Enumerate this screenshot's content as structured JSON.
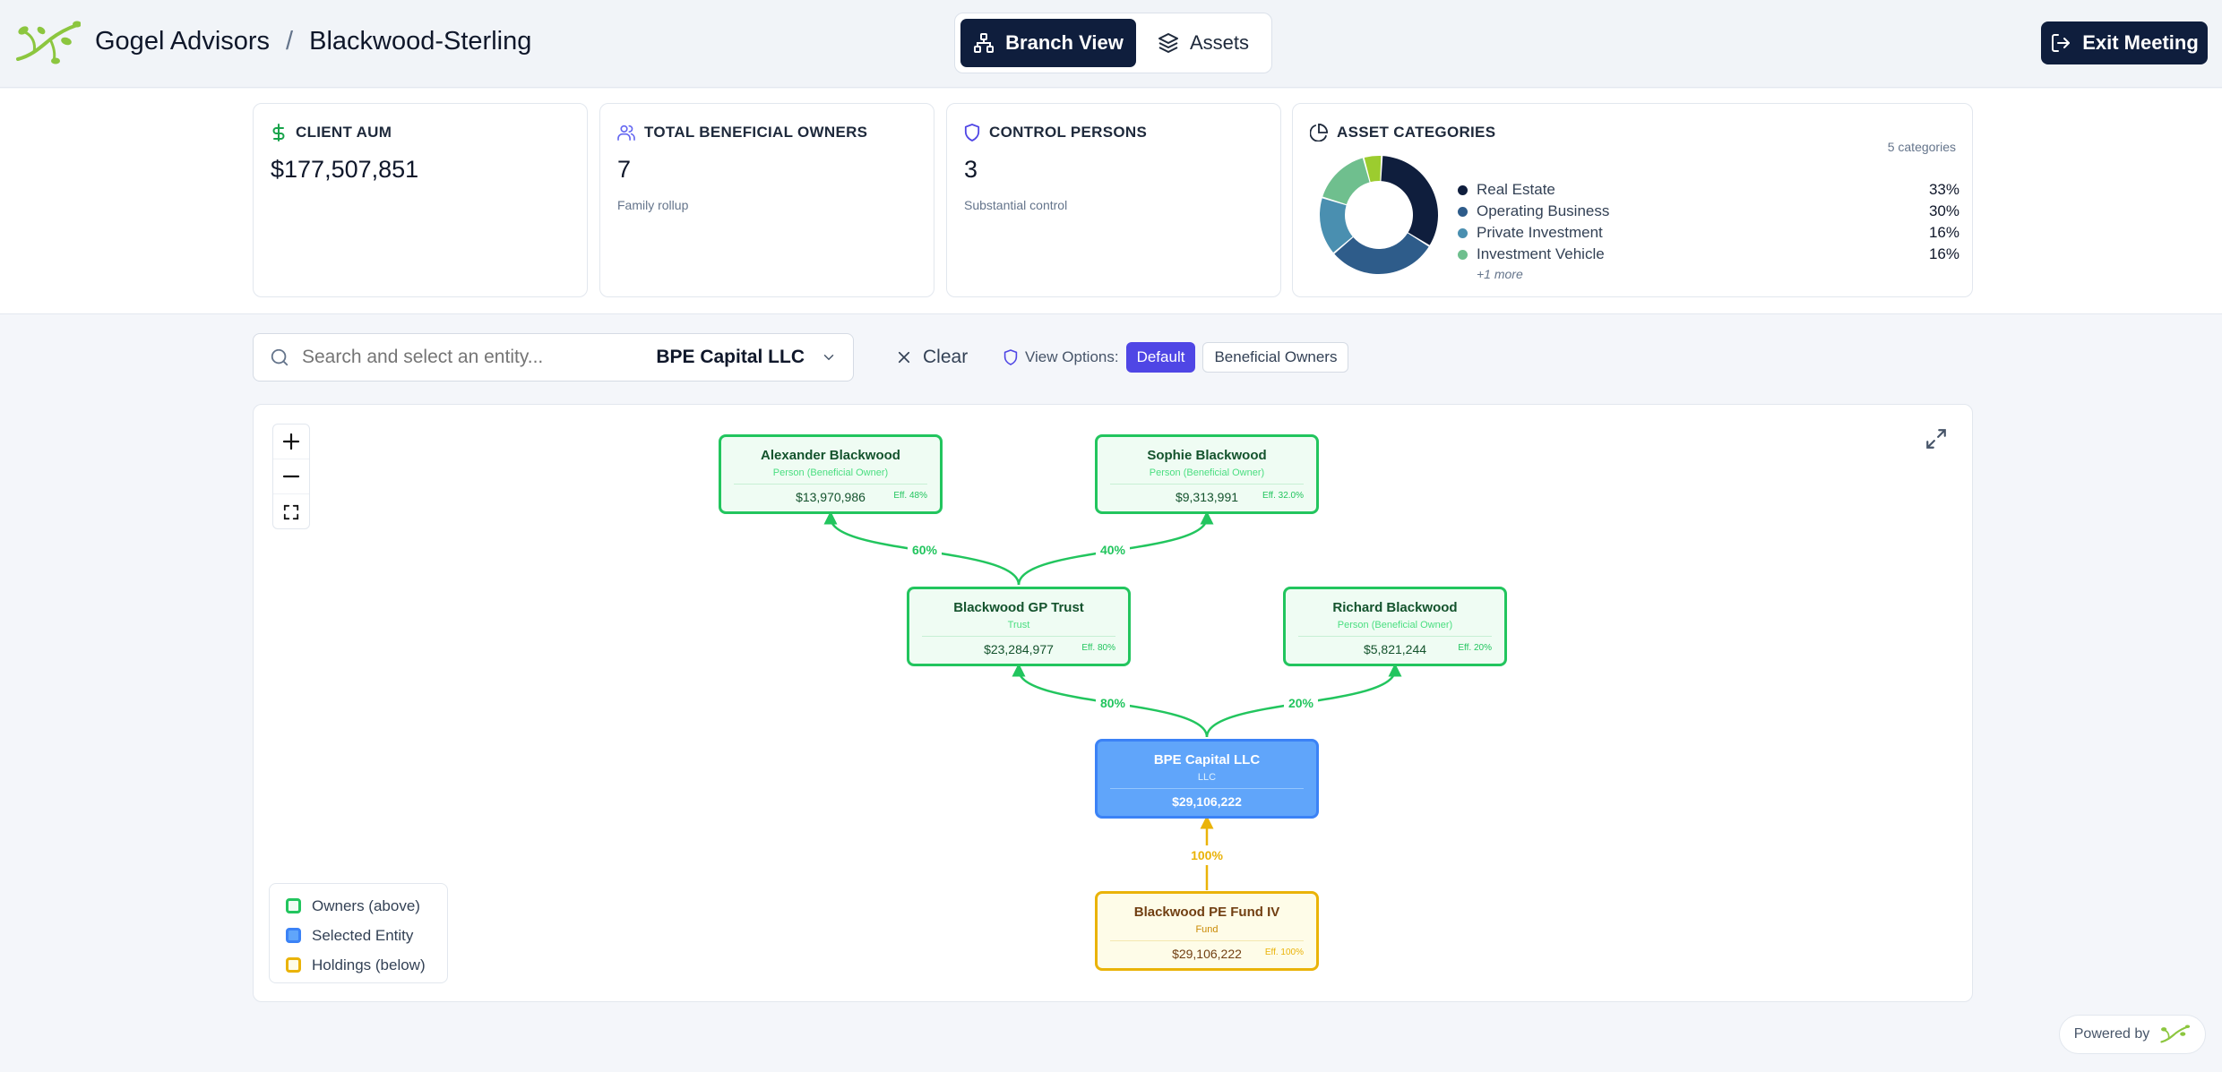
{
  "header": {
    "org": "Gogel Advisors",
    "separator": "/",
    "client": "Blackwood-Sterling",
    "tabs": [
      {
        "label": "Branch View",
        "active": true,
        "icon": "org-chart-icon"
      },
      {
        "label": "Assets",
        "active": false,
        "icon": "layers-icon"
      }
    ],
    "exit_label": "Exit Meeting"
  },
  "stats": {
    "aum": {
      "label": "CLIENT AUM",
      "value": "$177,507,851",
      "icon": "dollar-icon"
    },
    "owners": {
      "label": "TOTAL BENEFICIAL OWNERS",
      "value": "7",
      "sub": "Family rollup",
      "icon": "users-icon"
    },
    "control": {
      "label": "CONTROL PERSONS",
      "value": "3",
      "sub": "Substantial control",
      "icon": "shield-icon"
    },
    "categories": {
      "label": "ASSET CATEGORIES",
      "count": "5 categories",
      "items": [
        {
          "name": "Real Estate",
          "pct": "33%",
          "value": 33,
          "color": "#0f1e3d"
        },
        {
          "name": "Operating Business",
          "pct": "30%",
          "value": 30,
          "color": "#2e5c8a"
        },
        {
          "name": "Private Investment",
          "pct": "16%",
          "value": 16,
          "color": "#4a8fb0"
        },
        {
          "name": "Investment Vehicle",
          "pct": "16%",
          "value": 16,
          "color": "#6fbf8e"
        }
      ],
      "other": {
        "value": 5,
        "color": "#9ccc2f"
      },
      "more": "+1 more"
    }
  },
  "toolbar": {
    "search_placeholder": "Search and select an entity...",
    "selected_entity": "BPE Capital LLC",
    "clear_label": "Clear",
    "view_options_label": "View Options:",
    "options": [
      {
        "label": "Default",
        "active": true
      },
      {
        "label": "Beneficial Owners",
        "active": false
      }
    ]
  },
  "graph": {
    "nodes": {
      "alexander": {
        "name": "Alexander Blackwood",
        "type": "Person (Beneficial Owner)",
        "value": "$13,970,986",
        "eff": "Eff. 48%"
      },
      "sophie": {
        "name": "Sophie Blackwood",
        "type": "Person (Beneficial Owner)",
        "value": "$9,313,991",
        "eff": "Eff. 32.0%"
      },
      "trust": {
        "name": "Blackwood GP Trust",
        "type": "Trust",
        "value": "$23,284,977",
        "eff": "Eff. 80%"
      },
      "richard": {
        "name": "Richard Blackwood",
        "type": "Person (Beneficial Owner)",
        "value": "$5,821,244",
        "eff": "Eff. 20%"
      },
      "bpe": {
        "name": "BPE Capital LLC",
        "type": "LLC",
        "value": "$29,106,222"
      },
      "fund": {
        "name": "Blackwood PE Fund IV",
        "type": "Fund",
        "value": "$29,106,222",
        "eff": "Eff. 100%"
      }
    },
    "edges": {
      "trust_alexander": "60%",
      "trust_sophie": "40%",
      "bpe_trust": "80%",
      "bpe_richard": "20%",
      "fund_bpe": "100%"
    },
    "legend": [
      {
        "label": "Owners (above)",
        "color": "#22c55e",
        "fill": "#effcf3"
      },
      {
        "label": "Selected Entity",
        "color": "#3b82f6",
        "fill": "#60a5fa"
      },
      {
        "label": "Holdings (below)",
        "color": "#eab308",
        "fill": "#fefce8"
      }
    ]
  },
  "footer": {
    "powered_by": "Powered by"
  }
}
